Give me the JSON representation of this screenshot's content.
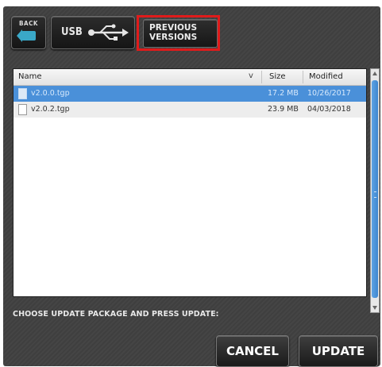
{
  "caption_fragment": "CANC... (cropped)",
  "toolbar": {
    "back_label": "BACK",
    "usb_label": "USB",
    "previous_versions_label": "PREVIOUS\nVERSIONS",
    "highlight_color": "#e01b1b"
  },
  "table": {
    "columns": [
      "Name",
      "Size",
      "Modified"
    ],
    "sort_indicator": "v",
    "rows": [
      {
        "name": "v2.0.0.tgp",
        "size": "17.2 MB",
        "modified": "10/26/2017",
        "selected": true
      },
      {
        "name": "v2.0.2.tgp",
        "size": "23.9 MB",
        "modified": "04/03/2018",
        "selected": false
      }
    ]
  },
  "instruction": "CHOOSE UPDATE PACKAGE AND PRESS UPDATE:",
  "buttons": {
    "cancel": "CANCEL",
    "update": "UPDATE"
  },
  "colors": {
    "selection": "#4a90d9",
    "scroll_thumb": "#3d86d1",
    "panel_bg": "#454545"
  }
}
